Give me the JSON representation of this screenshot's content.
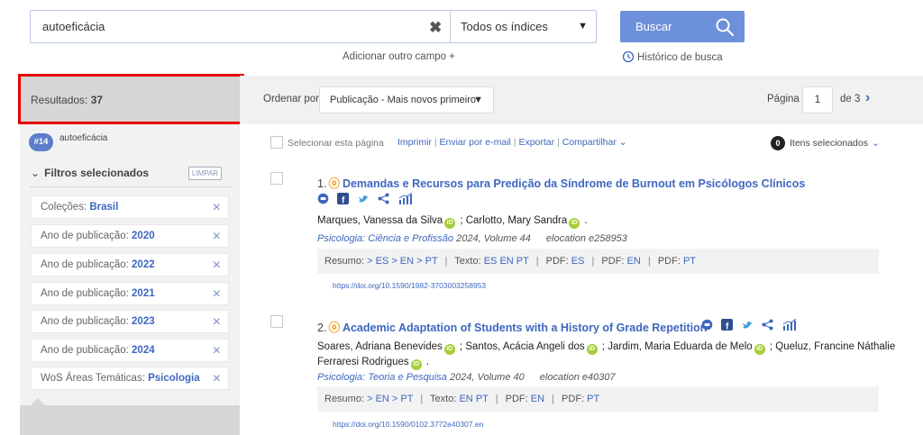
{
  "search": {
    "query": "autoeficácia",
    "index_selected": "Todos os índices",
    "button_label": "Buscar",
    "add_field": "Adicionar outro campo +",
    "history": "Histórico de busca"
  },
  "sidebar": {
    "results_label": "Resultados:",
    "results_count": "37",
    "query_badge": "#14",
    "query_text": "autoeficácia",
    "filters_title": "Filtros selecionados",
    "clear_label": "LIMPAR",
    "filters": [
      {
        "label": "Coleções:",
        "value": "Brasil"
      },
      {
        "label": "Ano de publicação:",
        "value": "2020"
      },
      {
        "label": "Ano de publicação:",
        "value": "2022"
      },
      {
        "label": "Ano de publicação:",
        "value": "2021"
      },
      {
        "label": "Ano de publicação:",
        "value": "2023"
      },
      {
        "label": "Ano de publicação:",
        "value": "2024"
      },
      {
        "label": "WoS Áreas Temáticas:",
        "value": "Psicologia"
      }
    ]
  },
  "toolbar": {
    "sort_label": "Ordenar por",
    "sort_value": "Publicação - Mais novos primeiro",
    "page_label": "Página",
    "page_value": "1",
    "page_total": "de 3"
  },
  "selection": {
    "select_page": "Selecionar esta página",
    "actions": [
      "Imprimir",
      "Enviar por e-mail",
      "Exportar",
      "Compartilhar"
    ],
    "selected_count": "0",
    "selected_label": "Itens selecionados"
  },
  "articles": [
    {
      "number": "1.",
      "title": "Demandas e Recursos para Predição da Síndrome de Burnout em Psicólogos Clínicos",
      "authors": [
        "Marques, Vanessa da Silva",
        "Carlotto, Mary Sandra"
      ],
      "journal": "Psicologia: Ciência e Profissão",
      "issue": "2024, Volume 44",
      "elocation": "elocation e258953",
      "resumo_label": "Resumo:",
      "resumo_links": [
        "> ES",
        "> EN",
        "> PT"
      ],
      "texto_label": "Texto:",
      "texto_links": [
        "ES",
        "EN",
        "PT"
      ],
      "pdf_groups": [
        {
          "label": "PDF:",
          "link": "ES"
        },
        {
          "label": "PDF:",
          "link": "EN"
        },
        {
          "label": "PDF:",
          "link": "PT"
        }
      ],
      "doi": "https://doi.org/10.1590/1982-3703003258953"
    },
    {
      "number": "2.",
      "title": "Academic Adaptation of Students with a History of Grade Repetition",
      "authors_line1": [
        "Soares, Adriana Benevides",
        "Santos, Acácia Angeli dos",
        "Jardim, Maria Eduarda de Melo",
        "Queluz, Francine Náthalie"
      ],
      "authors_line2": [
        "Ferraresi Rodrigues"
      ],
      "journal": "Psicologia: Teoria e Pesquisa",
      "issue": "2024, Volume 40",
      "elocation": "elocation e40307",
      "resumo_label": "Resumo:",
      "resumo_links": [
        "> EN",
        "> PT"
      ],
      "texto_label": "Texto:",
      "texto_links": [
        "EN",
        "PT"
      ],
      "pdf_groups": [
        {
          "label": "PDF:",
          "link": "EN"
        },
        {
          "label": "PDF:",
          "link": "PT"
        }
      ],
      "doi": "https://doi.org/10.1590/0102.3772e40307.en"
    }
  ],
  "colors": {
    "accent": "#3e67c0",
    "button": "#6d90da",
    "highlight": "#e30000",
    "orcid": "#a6ce39",
    "open_access": "#f39c12"
  },
  "icons": [
    "close-icon",
    "search-icon",
    "history-icon",
    "chevron-right-icon",
    "open-access-icon",
    "comment-icon",
    "facebook-icon",
    "twitter-icon",
    "share-icon",
    "metrics-icon",
    "orcid-icon"
  ]
}
